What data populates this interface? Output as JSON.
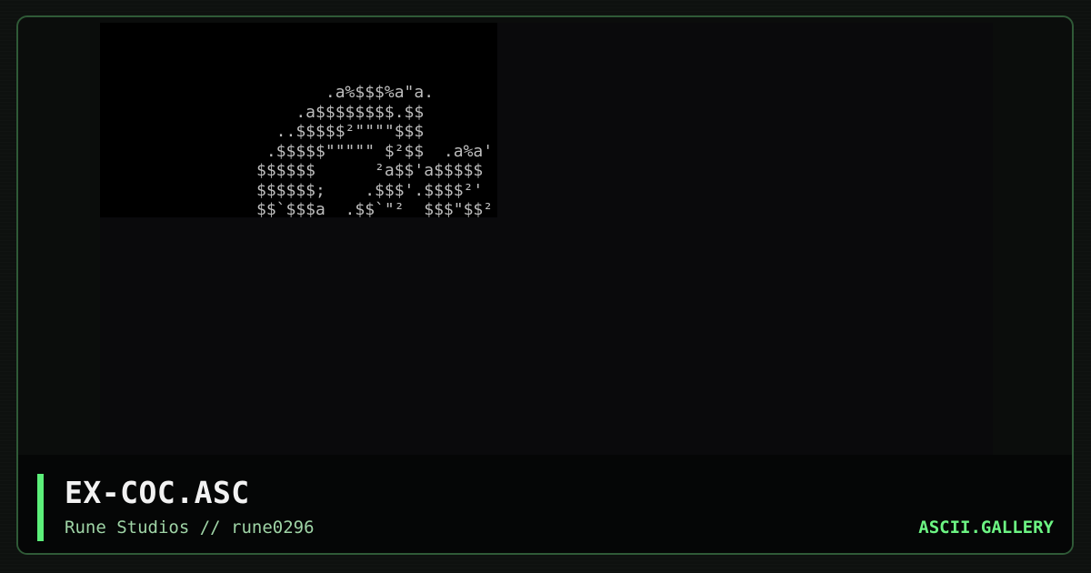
{
  "artwork": {
    "lines": [
      "       .a%$$$%a\"a.",
      "    .a$$$$$$$$.$$",
      "  ..$$$$$²\"\"\"\"$$$",
      " .$$$$$\"\"\"\"\" $²$$  .a%a'",
      "$$$$$$      ²a$$'a$$$$$",
      "$$$$$$;    .$$$'.$$$$²'",
      "$$`$$$a  .$$`\"²  $$$\"$$²"
    ]
  },
  "footer": {
    "title": "EX-COC.ASC",
    "subtitle": "Rune Studios // rune0296",
    "brand": "ASCII.GALLERY"
  },
  "colors": {
    "accent": "#5cf07a",
    "brand": "#6cf583",
    "border": "#2f5a37",
    "art_text": "#bdbdbd"
  }
}
